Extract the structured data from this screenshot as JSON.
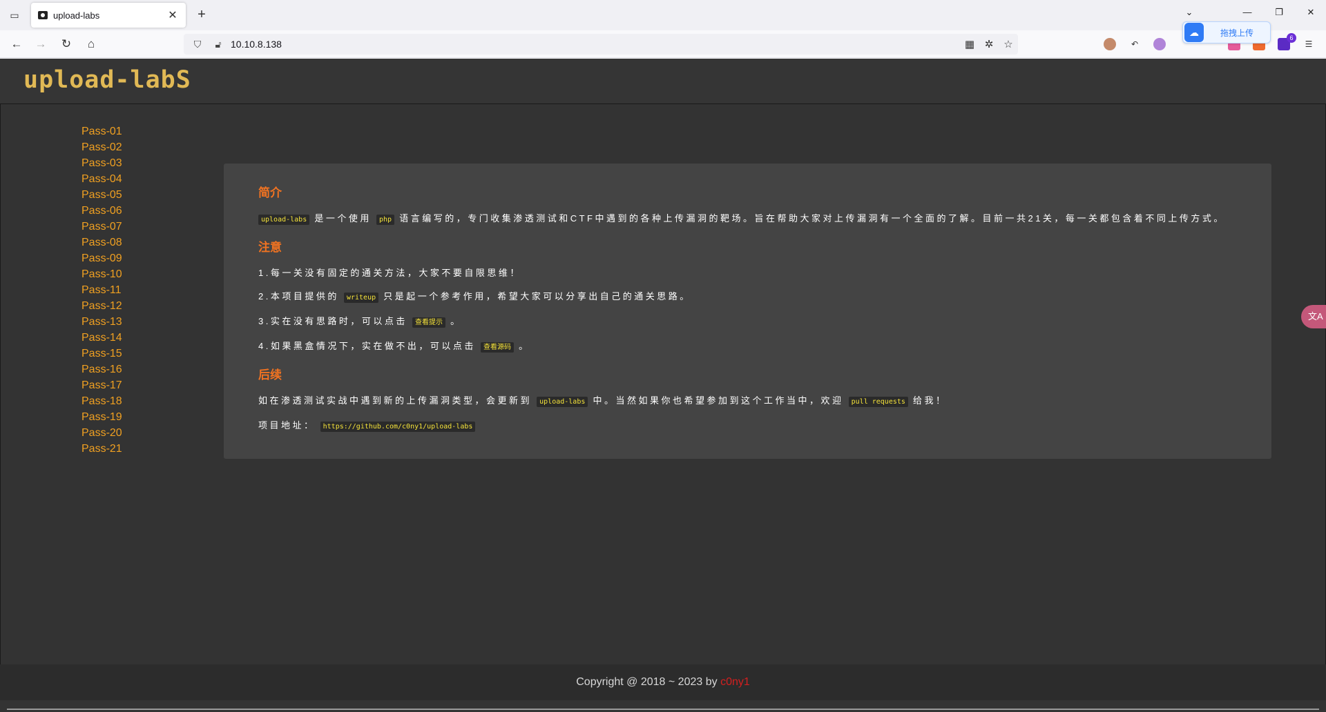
{
  "browser": {
    "tab_title": "upload-labs",
    "url": "10.10.8.138",
    "upload_popup_label": "拖拽上传",
    "badge_count": "6"
  },
  "site": {
    "logo_text": "upload-labS",
    "sidebar": [
      "Pass-01",
      "Pass-02",
      "Pass-03",
      "Pass-04",
      "Pass-05",
      "Pass-06",
      "Pass-07",
      "Pass-08",
      "Pass-09",
      "Pass-10",
      "Pass-11",
      "Pass-12",
      "Pass-13",
      "Pass-14",
      "Pass-15",
      "Pass-16",
      "Pass-17",
      "Pass-18",
      "Pass-19",
      "Pass-20",
      "Pass-21"
    ],
    "intro": {
      "heading": "简介",
      "code1": "upload-labs",
      "text1": "是一个使用",
      "code2": "php",
      "text2": "语言编写的，专门收集渗透测试和CTF中遇到的各种上传漏洞的靶场。旨在帮助大家对上传漏洞有一个全面的了解。目前一共21关，每一关都包含着不同上传方式。"
    },
    "notes": {
      "heading": "注意",
      "item1": "1.每一关没有固定的通关方法，大家不要自限思维！",
      "item2_pre": "2.本项目提供的",
      "item2_code": "writeup",
      "item2_post": "只是起一个参考作用，希望大家可以分享出自己的通关思路。",
      "item3_pre": "3.实在没有思路时，可以点击",
      "item3_code": "查看提示",
      "item3_post": "。",
      "item4_pre": "4.如果黑盒情况下，实在做不出，可以点击",
      "item4_code": "查看源码",
      "item4_post": "。"
    },
    "followup": {
      "heading": "后续",
      "text_pre": "如在渗透测试实战中遇到新的上传漏洞类型，会更新到",
      "code1": "upload-labs",
      "text_mid": "中。当然如果你也希望参加到这个工作当中，欢迎",
      "code2": "pull requests",
      "text_post": "给我！",
      "addr_label": "项目地址：",
      "addr_url": "https://github.com/c0ny1/upload-labs"
    },
    "footer": {
      "copyright": "Copyright @ 2018 ~ 2023 by ",
      "author": "c0ny1"
    },
    "translate_icon": "文A"
  }
}
